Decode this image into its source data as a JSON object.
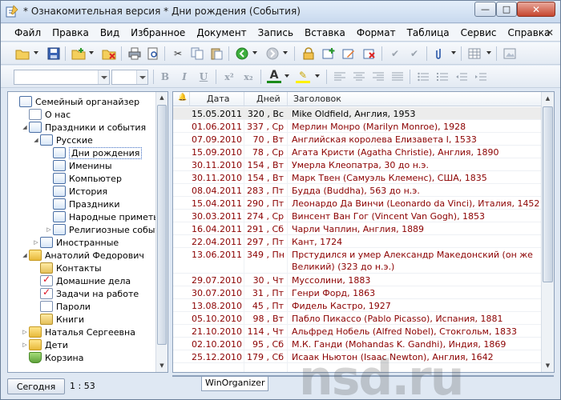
{
  "window": {
    "title": "* Ознакомительная версия * Дни рождения (События)",
    "controls": {
      "minimize": "—",
      "maximize": "□",
      "close": "✕"
    }
  },
  "menu": [
    "Файл",
    "Правка",
    "Вид",
    "Избранное",
    "Документ",
    "Запись",
    "Вставка",
    "Формат",
    "Таблица",
    "Сервис",
    "Справка"
  ],
  "toolbar1_icons": [
    "open-folder-icon",
    "save-icon",
    "new-record-icon",
    "delete-record-icon",
    "print-icon",
    "print-preview-icon",
    "cut-icon",
    "copy-icon",
    "paste-icon",
    "back-icon",
    "forward-icon",
    "lock-icon",
    "add-icon",
    "edit-icon",
    "remove-icon",
    "check-icon",
    "check-disabled-icon",
    "attach-icon",
    "table-icon",
    "frame-icon"
  ],
  "toolbar2": {
    "font_name": "",
    "font_size": "",
    "bold": "B",
    "italic": "I",
    "underline": "U",
    "superscript": "x²",
    "subscript": "x₂",
    "font_color": "A",
    "highlight": "✎"
  },
  "tree": {
    "items": [
      {
        "label": "Семейный органайзер",
        "icon": "organizer",
        "level": 0,
        "expander": ""
      },
      {
        "label": "О нас",
        "icon": "page",
        "level": 1,
        "expander": ""
      },
      {
        "label": "Праздники и события",
        "icon": "cal",
        "level": 1,
        "expander": "◢"
      },
      {
        "label": "Русские",
        "icon": "cal",
        "level": 2,
        "expander": "◢"
      },
      {
        "label": "Дни рождения",
        "icon": "cal",
        "level": 3,
        "expander": "",
        "selected": true
      },
      {
        "label": "Именины",
        "icon": "cal",
        "level": 3,
        "expander": ""
      },
      {
        "label": "Компьютер",
        "icon": "cal",
        "level": 3,
        "expander": ""
      },
      {
        "label": "История",
        "icon": "cal",
        "level": 3,
        "expander": ""
      },
      {
        "label": "Праздники",
        "icon": "cal",
        "level": 3,
        "expander": ""
      },
      {
        "label": "Народные приметы",
        "icon": "cal",
        "level": 3,
        "expander": ""
      },
      {
        "label": "Религиозные события",
        "icon": "cal",
        "level": 3,
        "expander": "▷"
      },
      {
        "label": "Иностранные",
        "icon": "cal",
        "level": 2,
        "expander": "▷"
      },
      {
        "label": "Анатолий Федорович",
        "icon": "folder",
        "level": 1,
        "expander": "◢"
      },
      {
        "label": "Контакты",
        "icon": "book",
        "level": 2,
        "expander": ""
      },
      {
        "label": "Домашние дела",
        "icon": "check",
        "level": 2,
        "expander": ""
      },
      {
        "label": "Задачи на работе",
        "icon": "check",
        "level": 2,
        "expander": ""
      },
      {
        "label": "Пароли",
        "icon": "page",
        "level": 2,
        "expander": ""
      },
      {
        "label": "Книги",
        "icon": "book",
        "level": 2,
        "expander": ""
      },
      {
        "label": "Наталья Сергеевна",
        "icon": "folder",
        "level": 1,
        "expander": "▷"
      },
      {
        "label": "Дети",
        "icon": "folder",
        "level": 1,
        "expander": "▷"
      },
      {
        "label": "Корзина",
        "icon": "basket",
        "level": 1,
        "expander": ""
      }
    ]
  },
  "grid": {
    "columns": [
      "Дата",
      "Дней",
      "Заголовок"
    ],
    "rows": [
      {
        "date": "15.05.2011",
        "days": "320 , Вс",
        "title": "Mike Oldfield, Англия, 1953"
      },
      {
        "date": "01.06.2011",
        "days": "337 , Ср",
        "title": "Мерлин Монро (Marilyn Monroe), 1928"
      },
      {
        "date": "07.09.2010",
        "days": "70 , Вт",
        "title": "Английская королева Елизавета I, 1533"
      },
      {
        "date": "15.09.2010",
        "days": "78 , Ср",
        "title": "Агата Кристи (Agatha Christie), Англия, 1890"
      },
      {
        "date": "30.11.2010",
        "days": "154 , Вт",
        "title": "Умерла Клеопатра, 30 до н.э."
      },
      {
        "date": "30.11.2010",
        "days": "154 , Вт",
        "title": "Марк Твен (Самуэль Клеменс), США, 1835"
      },
      {
        "date": "08.04.2011",
        "days": "283 , Пт",
        "title": "Будда (Buddha), 563 до н.э."
      },
      {
        "date": "15.04.2011",
        "days": "290 , Пт",
        "title": "Леонардо Да Винчи (Leonardo da Vinci), Италия, 1452"
      },
      {
        "date": "30.03.2011",
        "days": "274 , Ср",
        "title": "Винсент Ван Гог (Vincent Van Gogh), 1853"
      },
      {
        "date": "16.04.2011",
        "days": "291 , Сб",
        "title": "Чарли Чаплин, Англия, 1889"
      },
      {
        "date": "22.04.2011",
        "days": "297 , Пт",
        "title": "Кант, 1724"
      },
      {
        "date": "13.06.2011",
        "days": "349 , Пн",
        "title": "Прстудился и умер Александр Македонский (он же Великий) (323 до н.э.)"
      },
      {
        "date": "29.07.2010",
        "days": "30 , Чт",
        "title": "Муссолини, 1883"
      },
      {
        "date": "30.07.2010",
        "days": "31 , Пт",
        "title": "Генри Форд, 1863"
      },
      {
        "date": "13.08.2010",
        "days": "45 , Пт",
        "title": "Фидель Кастро, 1927"
      },
      {
        "date": "05.10.2010",
        "days": "98 , Вт",
        "title": "Пабло Пикассо (Pablo Picasso), Испания, 1881"
      },
      {
        "date": "21.10.2010",
        "days": "114 , Чт",
        "title": "Альфред Нобель (Alfred Nobel), Стокгольм, 1833"
      },
      {
        "date": "02.10.2010",
        "days": "95 , Сб",
        "title": "М.К. Ганди (Mohandas K. Gandhi), Индия, 1869"
      },
      {
        "date": "25.12.2010",
        "days": "179 , Сб",
        "title": "Исаак Ньютон (Isaac Newton), Англия, 1642"
      }
    ]
  },
  "status": {
    "today_button": "Сегодня",
    "time": "1 : 53",
    "tab_label": "WinOrganizer"
  },
  "watermark": "nsd.ru"
}
